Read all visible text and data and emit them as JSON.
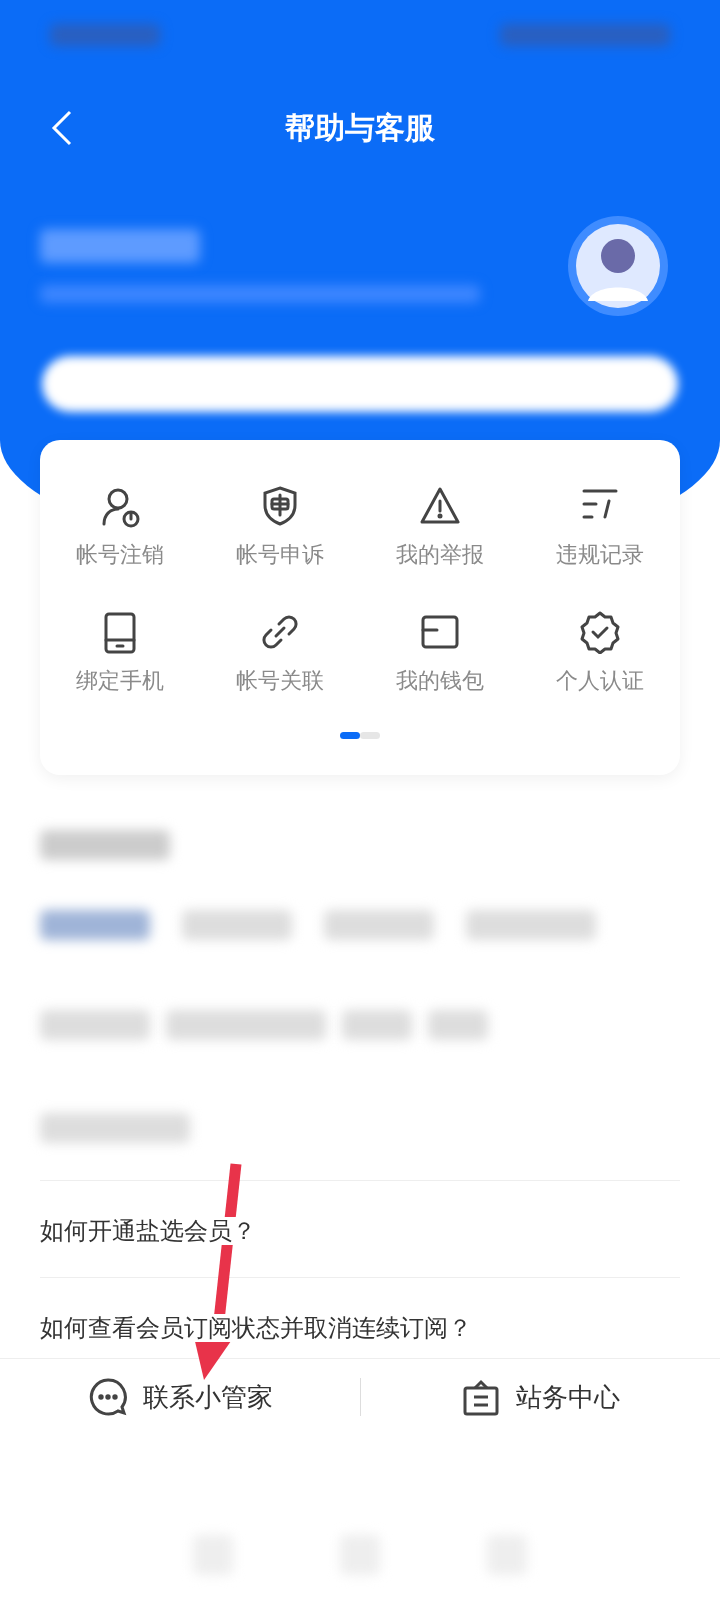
{
  "window": {
    "title": "帮助与客服"
  },
  "shortcuts": [
    {
      "label": "帐号注销"
    },
    {
      "label": "帐号申诉"
    },
    {
      "label": "我的举报"
    },
    {
      "label": "违规记录"
    },
    {
      "label": "绑定手机"
    },
    {
      "label": "帐号关联"
    },
    {
      "label": "我的钱包"
    },
    {
      "label": "个人认证"
    }
  ],
  "pager": [
    {
      "selected": true
    },
    {
      "selected": false
    }
  ],
  "questions": [
    {
      "text": "如何开通盐选会员？"
    },
    {
      "text": "如何查看会员订阅状态并取消连续订阅？"
    }
  ],
  "bottom_actions": [
    {
      "label": "联系小管家"
    },
    {
      "label": "站务中心"
    }
  ]
}
